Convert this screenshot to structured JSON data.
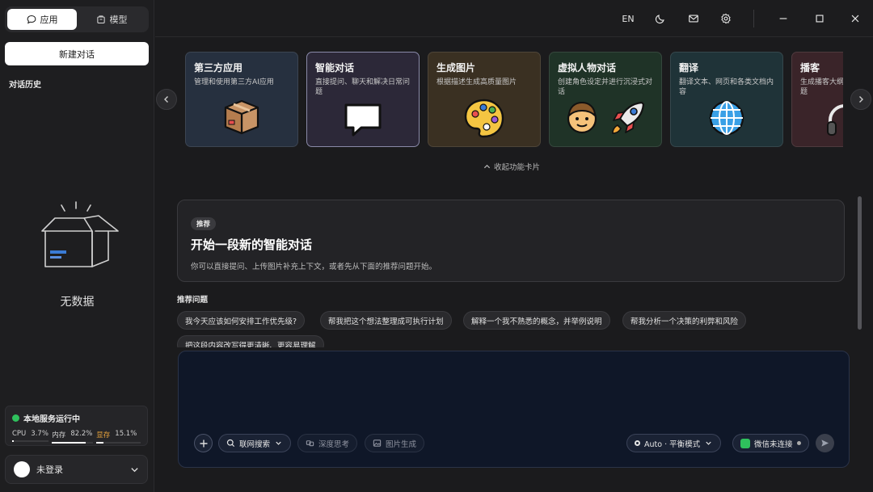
{
  "sidebar": {
    "tabs": [
      {
        "label": "应用",
        "icon": "chat-bubble-icon"
      },
      {
        "label": "模型",
        "icon": "package-icon"
      }
    ],
    "new_chat_label": "新建对话",
    "history_title": "对话历史",
    "empty_text": "无数据",
    "status": {
      "label": "本地服务运行中",
      "color": "#2fc15d",
      "cpu_label": "CPU",
      "cpu_value": "3.7%",
      "cpu_fraction": 0.037,
      "mem_label": "内存",
      "mem_value": "82.2%",
      "mem_fraction": 0.822,
      "vram_label": "显存",
      "vram_value": "15.1%",
      "vram_fraction": 0.151
    },
    "login_label": "未登录"
  },
  "topbar": {
    "lang": "EN",
    "icons": [
      "moon-icon",
      "mail-icon",
      "gear-icon",
      "minimize-icon",
      "maximize-icon",
      "close-icon"
    ]
  },
  "cards": [
    {
      "title": "第三方应用",
      "desc": "管理和使用第三方AI应用",
      "bg": "#26303f",
      "icon": "package-box-icon"
    },
    {
      "title": "智能对话",
      "desc": "直接提问、聊天和解决日常问题",
      "bg": "#2c2838",
      "icon": "speech-bubble-icon"
    },
    {
      "title": "生成图片",
      "desc": "根据描述生成高质量图片",
      "bg": "#3a3022",
      "icon": "palette-icon"
    },
    {
      "title": "虚拟人物对话",
      "desc": "创建角色设定并进行沉浸式对话",
      "bg": "#1f3327",
      "icon": "person-rocket-icon"
    },
    {
      "title": "翻译",
      "desc": "翻译文本、网页和各类文档内容",
      "bg": "#1f3338",
      "icon": "globe-icon"
    },
    {
      "title": "播客",
      "desc": "生成播客大纲、脚本和互动问题",
      "bg": "#3a2429",
      "icon": "headphones-icon"
    }
  ],
  "collapse_label": "收起功能卡片",
  "hero": {
    "badge": "推荐",
    "title": "开始一段新的智能对话",
    "subtitle": "你可以直接提问、上传图片补充上下文，或者先从下面的推荐问题开始。"
  },
  "recommend_title": "推荐问题",
  "chips": [
    "我今天应该如何安排工作优先级?",
    "帮我把这个想法整理成可执行计划",
    "解释一个我不熟悉的概念，并举例说明",
    "帮我分析一个决策的利弊和风险",
    "把这段内容改写得更清晰、更容易理解"
  ],
  "composer": {
    "web_search_label": "联网搜索",
    "deep_think_label": "深度思考",
    "image_gen_label": "图片生成",
    "mode_label": "Auto · 平衡模式",
    "wechat_label": "微信未连接",
    "wechat_color": "#2fc15d"
  }
}
